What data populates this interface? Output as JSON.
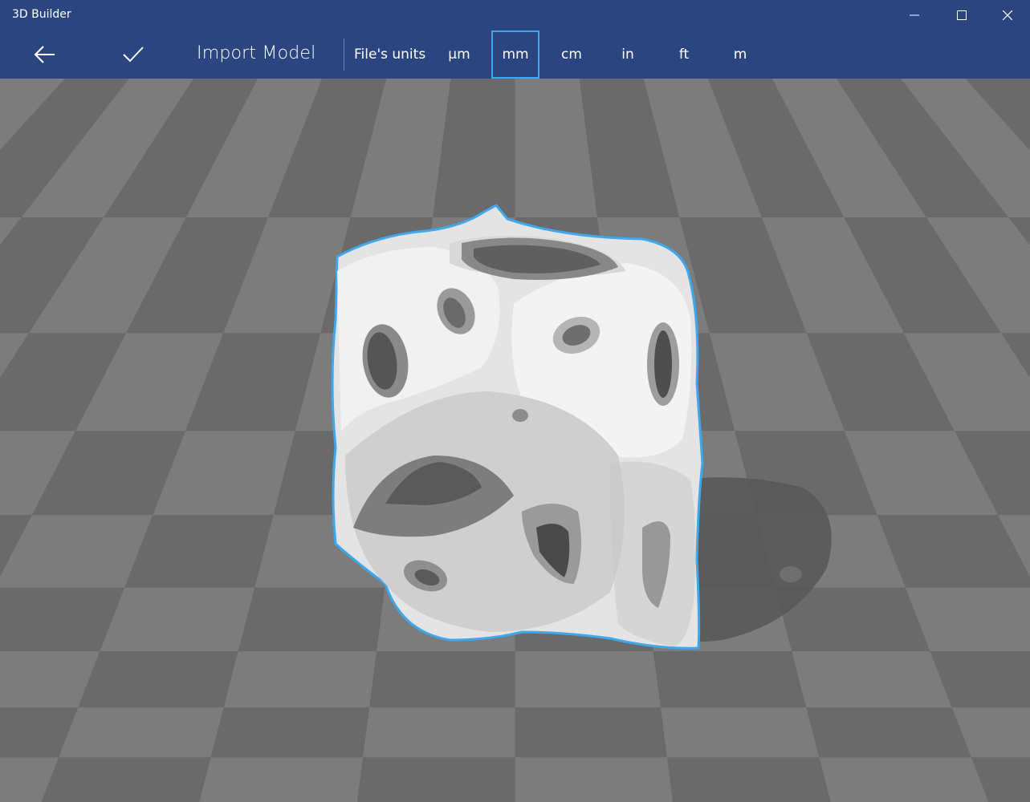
{
  "window": {
    "title": "3D Builder"
  },
  "toolbar": {
    "back_icon": "back-arrow-icon",
    "accept_icon": "checkmark-icon",
    "title": "Import Model",
    "units_label": "File's units",
    "units": [
      "µm",
      "mm",
      "cm",
      "in",
      "ft",
      "m"
    ],
    "selected_unit": "mm"
  },
  "viewport": {
    "grid": "checkerboard",
    "model": "3D mesh model",
    "selection_outline_color": "#3ea8ef"
  },
  "colors": {
    "chrome": "#2b4580",
    "accent": "#3ea8ef",
    "floor_dark": "#6a6a6a",
    "floor_light": "#7c7c7c"
  }
}
